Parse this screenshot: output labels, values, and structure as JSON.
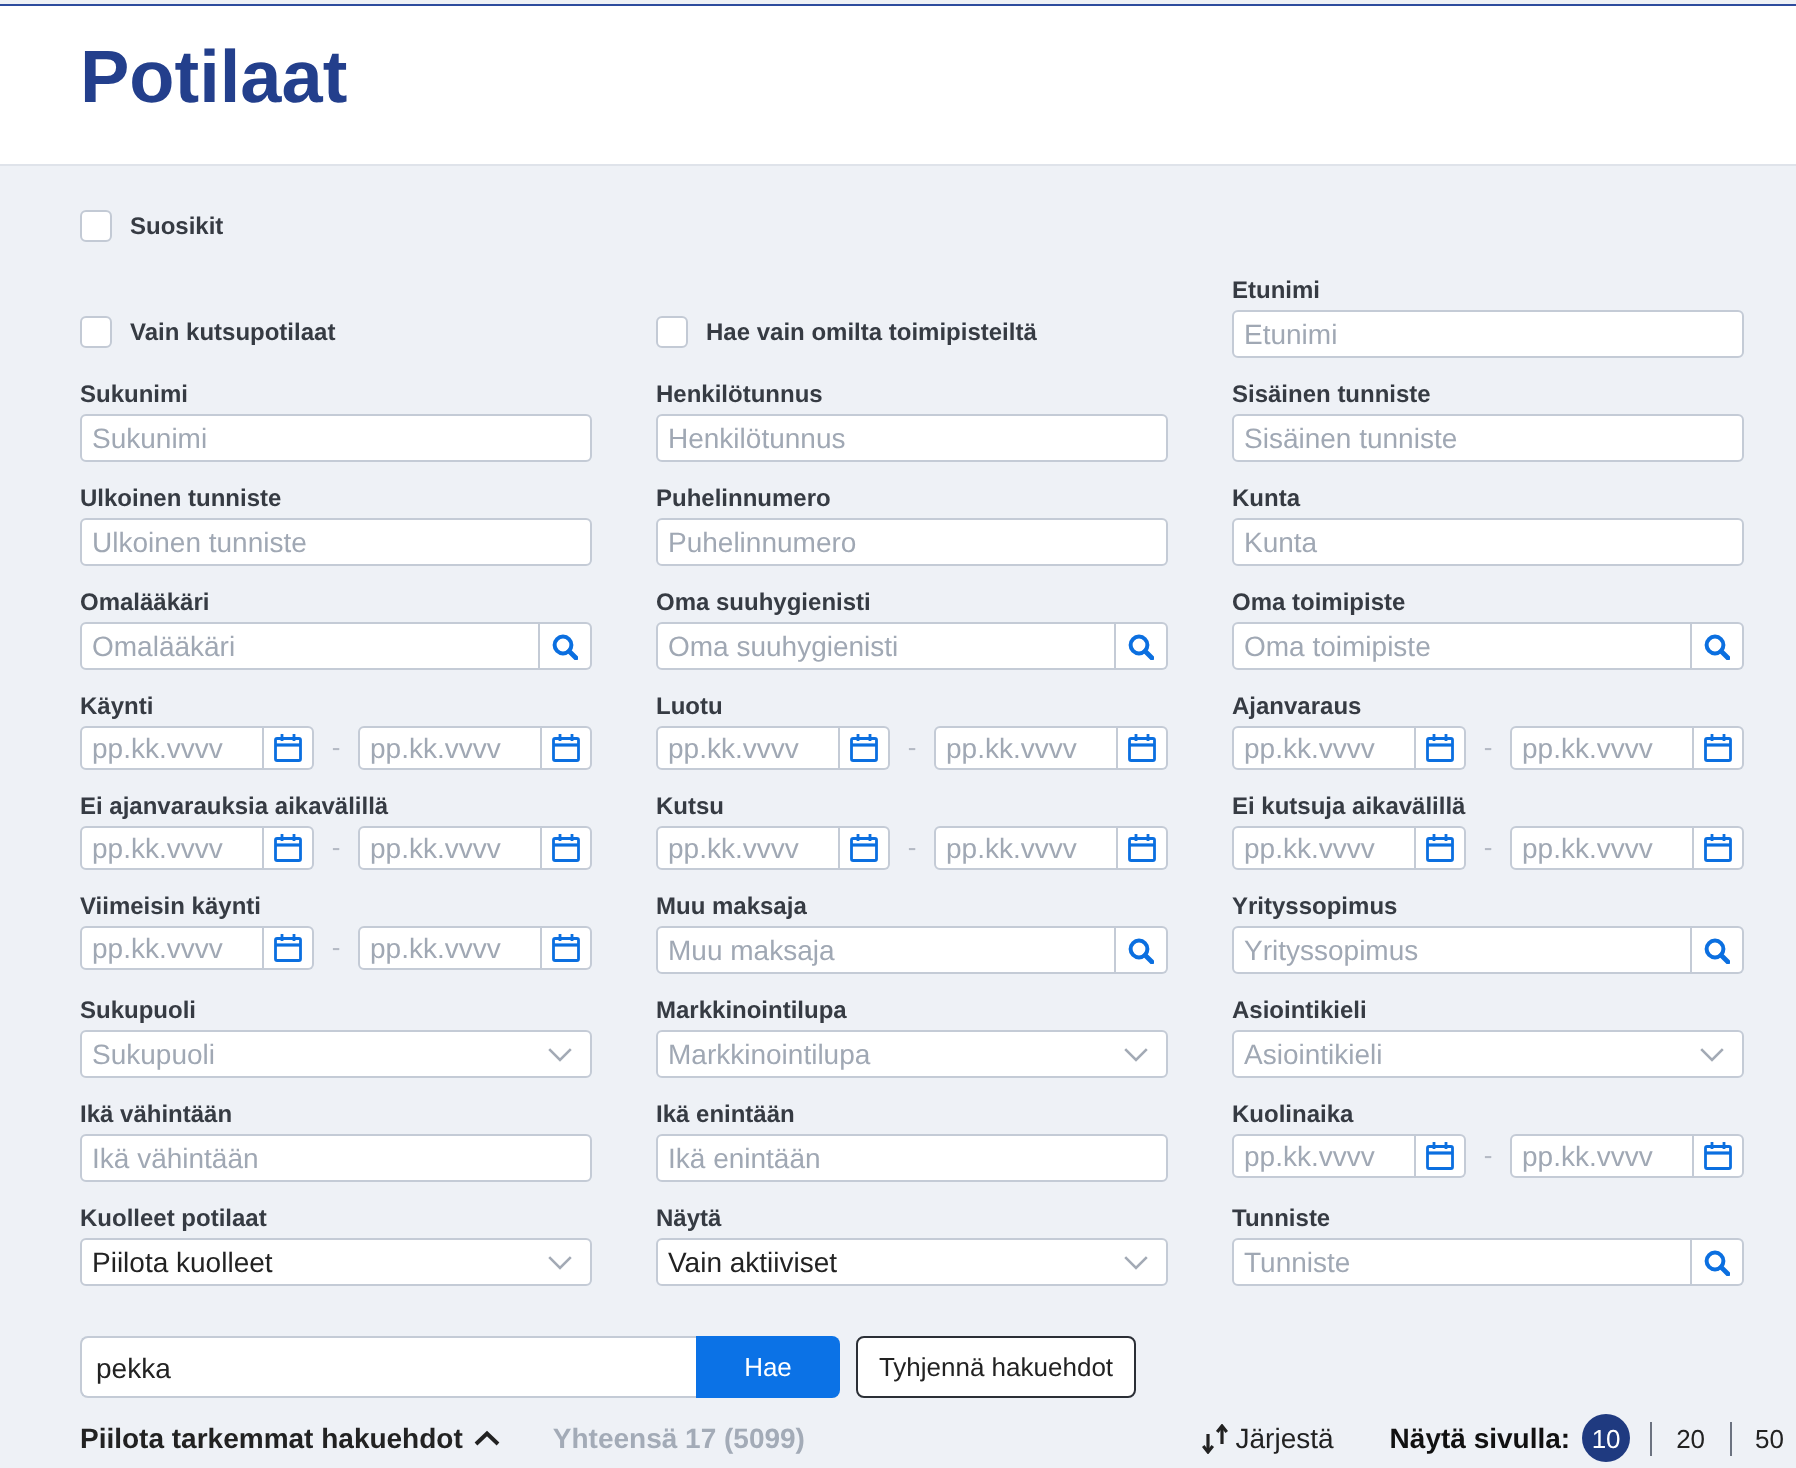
{
  "header": {
    "title": "Potilaat"
  },
  "favorites": {
    "label": "Suosikit",
    "checked": false
  },
  "filters": [
    {
      "kind": "checkbox",
      "label": "Vain kutsupotilaat",
      "checked": false
    },
    {
      "kind": "checkbox",
      "label": "Hae vain omilta toimipisteiltä",
      "checked": false
    },
    {
      "kind": "text",
      "label": "Etunimi",
      "placeholder": "Etunimi"
    },
    {
      "kind": "text",
      "label": "Sukunimi",
      "placeholder": "Sukunimi"
    },
    {
      "kind": "text",
      "label": "Henkilötunnus",
      "placeholder": "Henkilötunnus"
    },
    {
      "kind": "text",
      "label": "Sisäinen tunniste",
      "placeholder": "Sisäinen tunniste"
    },
    {
      "kind": "text",
      "label": "Ulkoinen tunniste",
      "placeholder": "Ulkoinen tunniste"
    },
    {
      "kind": "text",
      "label": "Puhelinnumero",
      "placeholder": "Puhelinnumero"
    },
    {
      "kind": "text",
      "label": "Kunta",
      "placeholder": "Kunta"
    },
    {
      "kind": "search",
      "label": "Omalääkäri",
      "placeholder": "Omalääkäri"
    },
    {
      "kind": "search",
      "label": "Oma suuhygienisti",
      "placeholder": "Oma suuhygienisti"
    },
    {
      "kind": "search",
      "label": "Oma toimipiste",
      "placeholder": "Oma toimipiste"
    },
    {
      "kind": "date_range",
      "label": "Käynti",
      "from_placeholder": "pp.kk.vvvv",
      "separator": "-",
      "to_placeholder": "pp.kk.vvvv"
    },
    {
      "kind": "date_range",
      "label": "Luotu",
      "from_placeholder": "pp.kk.vvvv",
      "separator": "-",
      "to_placeholder": "pp.kk.vvvv"
    },
    {
      "kind": "date_range",
      "label": "Ajanvaraus",
      "from_placeholder": "pp.kk.vvvv",
      "separator": "-",
      "to_placeholder": "pp.kk.vvvv"
    },
    {
      "kind": "date_range",
      "label": "Ei ajanvarauksia aikavälillä",
      "from_placeholder": "pp.kk.vvvv",
      "separator": "-",
      "to_placeholder": "pp.kk.vvvv"
    },
    {
      "kind": "date_range",
      "label": "Kutsu",
      "from_placeholder": "pp.kk.vvvv",
      "separator": "-",
      "to_placeholder": "pp.kk.vvvv"
    },
    {
      "kind": "date_range",
      "label": "Ei kutsuja aikavälillä",
      "from_placeholder": "pp.kk.vvvv",
      "separator": "-",
      "to_placeholder": "pp.kk.vvvv"
    },
    {
      "kind": "date_range",
      "label": "Viimeisin käynti",
      "from_placeholder": "pp.kk.vvvv",
      "separator": "-",
      "to_placeholder": "pp.kk.vvvv"
    },
    {
      "kind": "search",
      "label": "Muu maksaja",
      "placeholder": "Muu maksaja"
    },
    {
      "kind": "search",
      "label": "Yrityssopimus",
      "placeholder": "Yrityssopimus"
    },
    {
      "kind": "select",
      "label": "Sukupuoli",
      "placeholder": "Sukupuoli"
    },
    {
      "kind": "select",
      "label": "Markkinointilupa",
      "placeholder": "Markkinointilupa"
    },
    {
      "kind": "select",
      "label": "Asiointikieli",
      "placeholder": "Asiointikieli"
    },
    {
      "kind": "text",
      "label": "Ikä vähintään",
      "placeholder": "Ikä vähintään"
    },
    {
      "kind": "text",
      "label": "Ikä enintään",
      "placeholder": "Ikä enintään"
    },
    {
      "kind": "date_range",
      "label": "Kuolinaika",
      "from_placeholder": "pp.kk.vvvv",
      "separator": "-",
      "to_placeholder": "pp.kk.vvvv"
    },
    {
      "kind": "select",
      "label": "Kuolleet potilaat",
      "value": "Piilota kuolleet"
    },
    {
      "kind": "select",
      "label": "Näytä",
      "value": "Vain aktiiviset"
    },
    {
      "kind": "search",
      "label": "Tunniste",
      "placeholder": "Tunniste"
    }
  ],
  "search": {
    "value": "pekka",
    "button": "Hae",
    "clear_button": "Tyhjennä hakuehdot"
  },
  "footer": {
    "toggle": {
      "label": "Piilota tarkemmat hakuehdot",
      "expanded": true
    },
    "total": "Yhteensä 17 (5099)",
    "sort": "Järjestä",
    "page_size": {
      "label": "Näytä sivulla:",
      "options": [
        {
          "label": "10",
          "selected": true
        },
        {
          "label": "20",
          "selected": false
        },
        {
          "label": "50",
          "selected": false
        }
      ]
    }
  }
}
